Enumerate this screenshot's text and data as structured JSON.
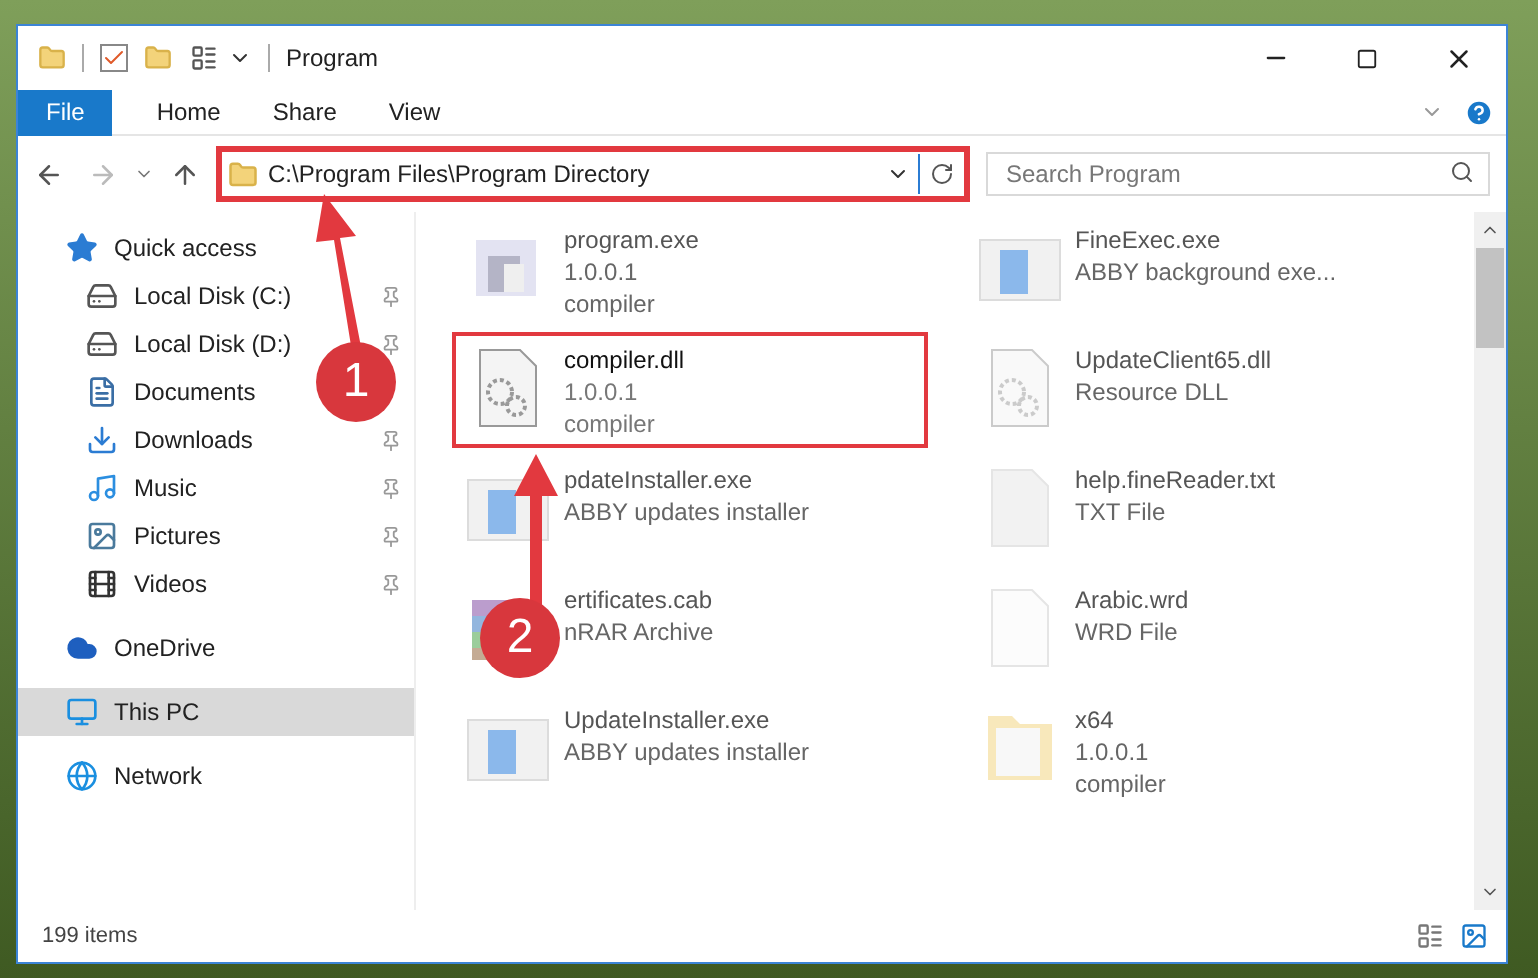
{
  "window": {
    "title": "Program"
  },
  "ribbon_tabs": [
    {
      "label": "File",
      "selected": true
    },
    {
      "label": "Home",
      "selected": false
    },
    {
      "label": "Share",
      "selected": false
    },
    {
      "label": "View",
      "selected": false
    }
  ],
  "address_bar": {
    "value": "C:\\Program Files\\Program Directory",
    "highlighted": true
  },
  "search": {
    "placeholder": "Search Program"
  },
  "sidebar": {
    "items": [
      {
        "label": "Quick access",
        "kind": "star",
        "selected": false,
        "children": [
          {
            "label": "Local Disk (C:)",
            "kind": "drive-c",
            "pinned": true
          },
          {
            "label": "Local Disk (D:)",
            "kind": "drive",
            "pinned": true
          },
          {
            "label": "Documents",
            "kind": "documents",
            "pinned": false
          },
          {
            "label": "Downloads",
            "kind": "downloads",
            "pinned": true
          },
          {
            "label": "Music",
            "kind": "music",
            "pinned": true
          },
          {
            "label": "Pictures",
            "kind": "pictures",
            "pinned": true
          },
          {
            "label": "Videos",
            "kind": "videos",
            "pinned": true
          }
        ]
      },
      {
        "label": "OneDrive",
        "kind": "cloud",
        "selected": false
      },
      {
        "label": "This PC",
        "kind": "pc",
        "selected": true
      },
      {
        "label": "Network",
        "kind": "network",
        "selected": false
      }
    ]
  },
  "files": [
    {
      "name": "program.exe",
      "lines": [
        "1.0.0.1",
        "compiler"
      ],
      "kind": "app",
      "faded": true,
      "selected": false
    },
    {
      "name": "FineExec.exe",
      "lines": [
        "ABBY background exe..."
      ],
      "kind": "exe",
      "faded": true,
      "selected": false
    },
    {
      "name": "compiler.dll",
      "lines": [
        "1.0.0.1",
        "compiler"
      ],
      "kind": "dll",
      "faded": false,
      "selected": true
    },
    {
      "name": "UpdateClient65.dll",
      "lines": [
        "Resource DLL"
      ],
      "kind": "dll",
      "faded": true,
      "selected": false
    },
    {
      "name": "pdateInstaller.exe",
      "lines": [
        "ABBY updates installer"
      ],
      "kind": "exe",
      "faded": true,
      "selected": false
    },
    {
      "name": "help.fineReader.txt",
      "lines": [
        "TXT File"
      ],
      "kind": "text",
      "faded": true,
      "selected": false
    },
    {
      "name": "ertificates.cab",
      "lines": [
        "nRAR Archive"
      ],
      "kind": "archive",
      "faded": true,
      "selected": false
    },
    {
      "name": "Arabic.wrd",
      "lines": [
        "WRD File"
      ],
      "kind": "blank",
      "faded": true,
      "selected": false
    },
    {
      "name": "UpdateInstaller.exe",
      "lines": [
        "ABBY updates installer"
      ],
      "kind": "exe",
      "faded": true,
      "selected": false
    },
    {
      "name": "x64",
      "lines": [
        "1.0.0.1",
        "compiler"
      ],
      "kind": "folder",
      "faded": true,
      "selected": false
    }
  ],
  "status_bar": {
    "count": "199 items"
  },
  "annotations": [
    {
      "number": "1"
    },
    {
      "number": "2"
    }
  ]
}
